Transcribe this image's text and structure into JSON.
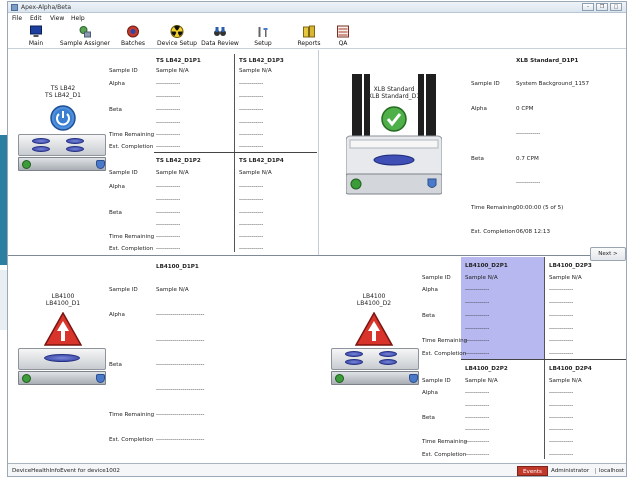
{
  "window": {
    "title": "Apex-Alpha/Beta"
  },
  "menu": [
    "File",
    "Edit",
    "View",
    "Help"
  ],
  "toolbar": [
    {
      "label": "Main",
      "icon": "monitor-icon"
    },
    {
      "label": "Sample Assigner",
      "icon": "sample-assigner-icon"
    },
    {
      "label": "Batches",
      "icon": "batches-icon"
    },
    {
      "label": "Device Setup",
      "icon": "radiation-icon"
    },
    {
      "label": "Data Review",
      "icon": "binoculars-icon"
    },
    {
      "label": "Setup",
      "icon": "tools-icon"
    },
    {
      "label": "Reports",
      "icon": "reports-icon"
    },
    {
      "label": "QA",
      "icon": "qa-chart-icon"
    }
  ],
  "labels": {
    "sample_id": "Sample ID",
    "alpha": "Alpha",
    "beta": "Beta",
    "time_remaining": "Time Remaining",
    "est_completion": "Est. Completion"
  },
  "dashes_short": "------------",
  "dashes_long": "------------------------",
  "ts": {
    "name_line1": "TS LB42",
    "name_line2": "TS LB42_D1",
    "p1": {
      "header": "TS LB42_D1P1",
      "sample_id": "Sample N/A"
    },
    "p2": {
      "header": "TS LB42_D1P2",
      "sample_id": "Sample N/A"
    },
    "p3": {
      "header": "TS LB42_D1P3",
      "sample_id": "Sample N/A"
    },
    "p4": {
      "header": "TS LB42_D1P4",
      "sample_id": "Sample N/A"
    }
  },
  "xlb": {
    "name_line1": "XLB Standard",
    "name_line2": "XLB Standard_D1",
    "header": "XLB Standard_D1P1",
    "sample_id": "System Background_1157",
    "alpha": "0 CPM",
    "beta": "0.7 CPM",
    "time_remaining": "00:00:00 (5 of 5)",
    "est_completion": "06/08 12:13"
  },
  "lb_d1": {
    "name_line1": "LB4100",
    "name_line2": "LB4100_D1",
    "header": "LB4100_D1P1",
    "sample_id": "Sample N/A"
  },
  "lb_d2": {
    "name_line1": "LB4100",
    "name_line2": "LB4100_D2",
    "p1": {
      "header": "LB4100_D2P1",
      "sample_id": "Sample N/A"
    },
    "p2": {
      "header": "LB4100_D2P2",
      "sample_id": "Sample N/A"
    },
    "p3": {
      "header": "LB4100_D2P3",
      "sample_id": "Sample N/A"
    },
    "p4": {
      "header": "LB4100_D2P4",
      "sample_id": "Sample N/A"
    }
  },
  "next_button": "Next >",
  "status": {
    "message": "DeviceHealthInfoEvent for device1002",
    "events": "Events",
    "user": "Administrator",
    "host": "localhost"
  },
  "colors": {
    "accent_band": "#2d7fa2",
    "highlight": "#b6b8ef",
    "events": "#c0392b"
  }
}
